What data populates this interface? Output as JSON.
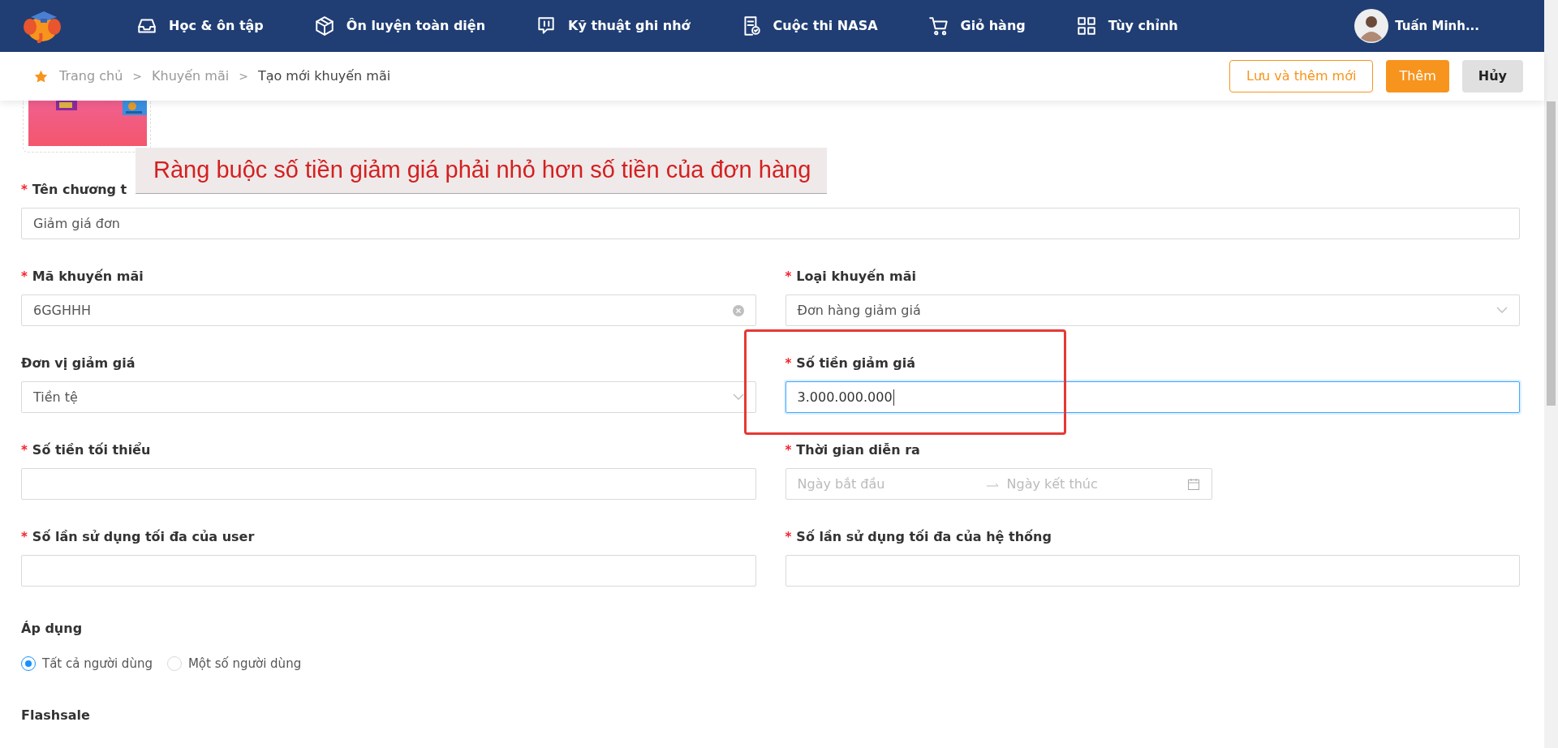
{
  "nav": {
    "items": [
      {
        "label": "Học & ôn tập",
        "kind": "inbox"
      },
      {
        "label": "Ôn luyện toàn diện",
        "kind": "cube"
      },
      {
        "label": "Kỹ thuật ghi nhớ",
        "kind": "chat"
      },
      {
        "label": "Cuộc thi NASA",
        "kind": "document"
      },
      {
        "label": "Giỏ hàng",
        "kind": "cart"
      },
      {
        "label": "Tùy chỉnh",
        "kind": "grid"
      }
    ],
    "user": {
      "name": "Tuấn Minh..."
    }
  },
  "breadcrumb": [
    {
      "text": "Trang chủ",
      "kind": "link"
    },
    {
      "text": ">",
      "kind": "separator"
    },
    {
      "text": "Khuyến mãi",
      "kind": "link"
    },
    {
      "text": ">",
      "kind": "separator"
    },
    {
      "text": "Tạo mới khuyến mãi",
      "kind": "current"
    }
  ],
  "actions": [
    {
      "label": "Lưu và thêm mới",
      "kind": "outline"
    },
    {
      "label": "Thêm",
      "kind": "primary"
    },
    {
      "label": "Hủy",
      "kind": "secondary"
    }
  ],
  "fields": [
    {
      "mark": "*",
      "label": "Tên chương t",
      "value": "Giảm giá đơn",
      "kind": "text",
      "focused": false,
      "highlighted": false
    },
    {
      "mark": "*",
      "label": "Mã khuyến mãi",
      "value": "6GGHHH",
      "kind": "clearable",
      "focused": false,
      "highlighted": false
    },
    {
      "mark": "*",
      "label": "Loại khuyến mãi",
      "value": "Đơn hàng giảm giá",
      "kind": "select",
      "focused": false,
      "highlighted": false
    },
    {
      "label": "Đơn vị giảm giá",
      "value": "Tiền tệ",
      "kind": "select",
      "focused": false,
      "highlighted": false
    },
    {
      "mark": "*",
      "label": "Số tiền giảm giá",
      "value": "3.000.000.000",
      "kind": "text",
      "focused": true,
      "highlighted": true
    },
    {
      "mark": "*",
      "label": "Số tiền tối thiểu",
      "kind": "text",
      "focused": false,
      "highlighted": false
    },
    {
      "mark": "*",
      "label": "Thời gian diễn ra",
      "kind": "date-range",
      "start_placeholder": "Ngày bắt đầu",
      "end_placeholder": "Ngày kết thúc",
      "focused": false,
      "highlighted": false
    },
    {
      "mark": "*",
      "label": "Số lần sử dụng tối đa của user",
      "kind": "text",
      "focused": false,
      "highlighted": false
    },
    {
      "mark": "*",
      "label": "Số lần sử dụng tối đa của hệ thống",
      "kind": "text",
      "focused": false,
      "highlighted": false
    }
  ],
  "apply": {
    "title": "Áp dụng",
    "options": [
      {
        "label": "Tất cả người dùng",
        "selected": true
      },
      {
        "label": "Một số người dùng",
        "selected": false
      }
    ]
  },
  "flashsale": {
    "title": "Flashsale"
  },
  "annotation": {
    "text": "Ràng buộc số tiền giảm giá phải nhỏ hơn số tiền của đơn hàng"
  }
}
